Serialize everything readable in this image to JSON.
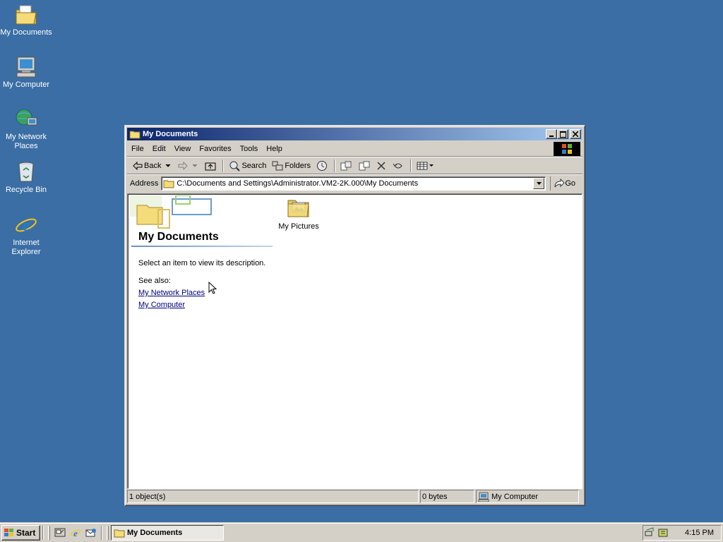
{
  "desktop": {
    "icons": [
      {
        "label": "My Documents",
        "icon": "my-documents-icon"
      },
      {
        "label": "My Computer",
        "icon": "my-computer-icon"
      },
      {
        "label_line1": "My Network",
        "label_line2": "Places",
        "icon": "network-places-icon"
      },
      {
        "label": "Recycle Bin",
        "icon": "recycle-bin-icon"
      },
      {
        "label_line1": "Internet",
        "label_line2": "Explorer",
        "icon": "internet-explorer-icon"
      }
    ]
  },
  "window": {
    "title": "My Documents",
    "menu": [
      "File",
      "Edit",
      "View",
      "Favorites",
      "Tools",
      "Help"
    ],
    "toolbar": {
      "back": "Back",
      "search": "Search",
      "folders": "Folders"
    },
    "address": {
      "label": "Address",
      "value": "C:\\Documents and Settings\\Administrator.VM2-2K.000\\My Documents",
      "go": "Go"
    },
    "webview": {
      "title": "My Documents",
      "description": "Select an item to view its description.",
      "see_also": "See also:",
      "links": [
        "My Network Places",
        "My Computer"
      ]
    },
    "items": [
      {
        "label": "My Pictures",
        "icon": "my-pictures-folder-icon"
      }
    ],
    "status": {
      "objects": "1 object(s)",
      "size": "0 bytes",
      "zone": "My Computer"
    }
  },
  "taskbar": {
    "start": "Start",
    "task": "My Documents",
    "clock": "4:15 PM"
  },
  "colors": {
    "desktop": "#3a6ea5",
    "titlebar_start": "#0a246a",
    "titlebar_end": "#a6caf0",
    "face": "#d4d0c8",
    "link": "#00007f"
  }
}
